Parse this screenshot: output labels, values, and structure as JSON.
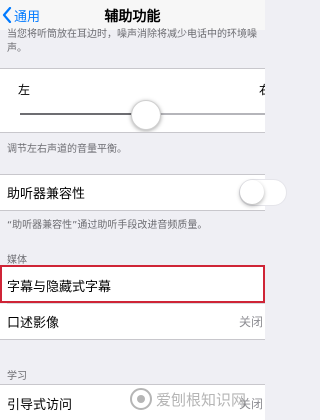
{
  "nav": {
    "back_label": "通用",
    "title": "辅助功能"
  },
  "top_desc": "当您将听筒放在耳边时，噪声消除将减少电话中的环境噪声。",
  "balance": {
    "left_label": "左",
    "right_label": "右",
    "level": 0.5
  },
  "balance_desc": "调节左右声道的音量平衡。",
  "hearing_aid": {
    "label": "助听器兼容性",
    "enabled": false
  },
  "hearing_aid_desc": "“助听器兼容性”通过助听手段改进音频质量。",
  "media_header": "媒体",
  "subtitles": {
    "label": "字幕与隐藏式字幕"
  },
  "audio_desc": {
    "label": "口述影像",
    "value": "关闭"
  },
  "learning_header": "学习",
  "guided_access": {
    "label": "引导式访问",
    "value": "关闭"
  },
  "watermark": "爱刨根知识网",
  "colors": {
    "accent": "#007aff",
    "highlight": "#cf2436"
  }
}
